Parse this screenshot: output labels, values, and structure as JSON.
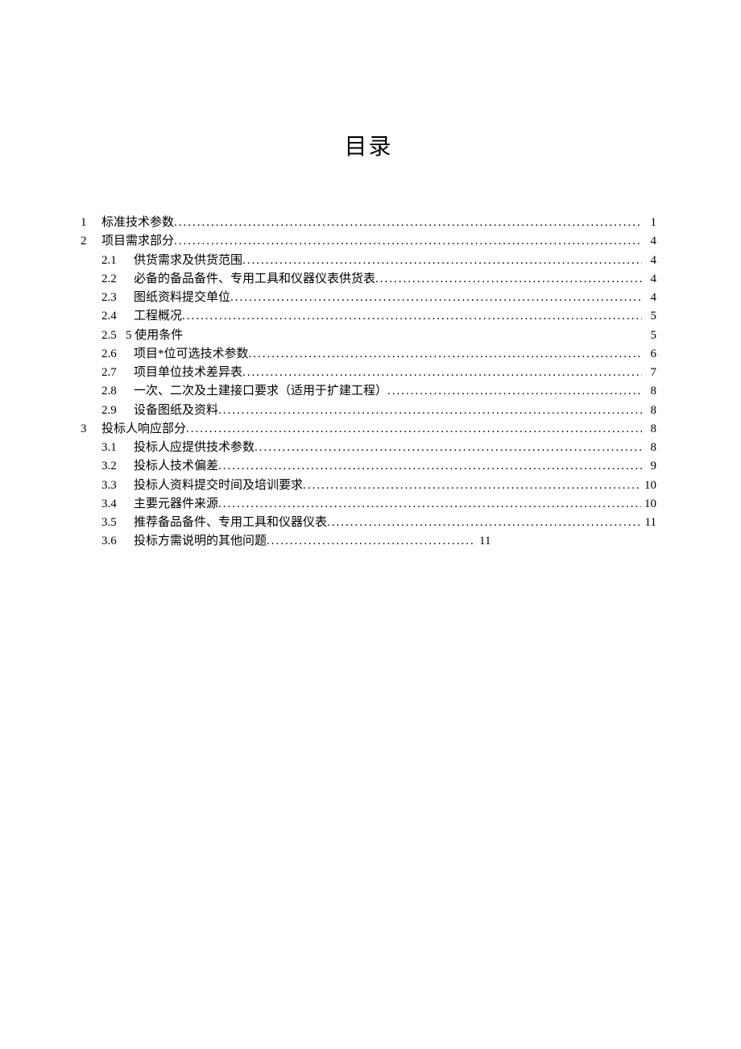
{
  "title": "目录",
  "toc": [
    {
      "level": 1,
      "num": "1",
      "label": "标准技术参数",
      "page": "1",
      "dots": true
    },
    {
      "level": 1,
      "num": "2",
      "label": "项目需求部分",
      "page": "4",
      "dots": true
    },
    {
      "level": 2,
      "num": "2.1",
      "label": "供货需求及供货范围",
      "page": "4",
      "dots": true
    },
    {
      "level": 2,
      "num": "2.2",
      "label": "必备的备品备件、专用工具和仪器仪表供货表",
      "page": "4",
      "dots": true
    },
    {
      "level": 2,
      "num": "2.3",
      "label": "图纸资料提交单位",
      "page": "4",
      "dots": true
    },
    {
      "level": 2,
      "num": "2.4",
      "label": "工程概况",
      "page": "5",
      "dots": true
    },
    {
      "level": 2,
      "num": "2.5",
      "label": "5 使用条件",
      "page": "5",
      "dots": false,
      "nospace": true
    },
    {
      "level": 2,
      "num": "2.6",
      "label": "项目*位可选技术参数",
      "page": "6",
      "dots": true
    },
    {
      "level": 2,
      "num": "2.7",
      "label": "项目单位技术差异表",
      "page": "7",
      "dots": true
    },
    {
      "level": 2,
      "num": "2.8",
      "label": "一次、二次及土建接口要求（适用于扩建工程）",
      "page": "8",
      "dots": true
    },
    {
      "level": 2,
      "num": "2.9",
      "label": "设备图纸及资料",
      "page": "8",
      "dots": true
    },
    {
      "level": 1,
      "num": "3",
      "label": "投标人响应部分",
      "page": "8",
      "dots": true
    },
    {
      "level": 2,
      "num": "3.1",
      "label": "投标人应提供技术参数",
      "page": "8",
      "dots": true
    },
    {
      "level": 2,
      "num": "3.2",
      "label": "投标人技术偏差",
      "page": "9",
      "dots": true
    },
    {
      "level": 2,
      "num": "3.3",
      "label": "投标人资料提交时间及培训要求",
      "page": "10",
      "dots": true
    },
    {
      "level": 2,
      "num": "3.4",
      "label": "主要元器件来源",
      "page": "10",
      "dots": true
    },
    {
      "level": 2,
      "num": "3.5",
      "label": "推荐备品备件、专用工具和仪器仪表",
      "page": "11",
      "dots": true
    },
    {
      "level": 2,
      "num": "3.6",
      "label": "投标方需说明的其他问题",
      "page": "11",
      "dots": true,
      "short": true
    }
  ]
}
